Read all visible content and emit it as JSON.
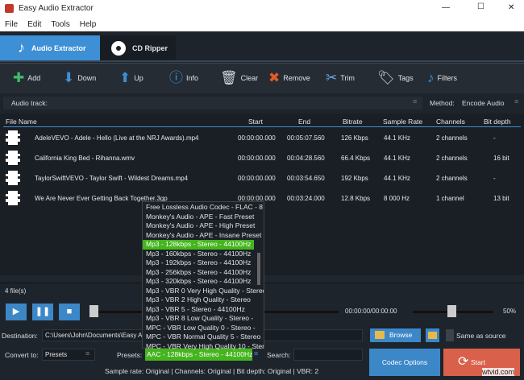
{
  "window": {
    "title": "Easy Audio Extractor",
    "minimize": "—",
    "maximize": "☐",
    "close": "✕"
  },
  "menu": [
    "File",
    "Edit",
    "Tools",
    "Help"
  ],
  "tabs": [
    {
      "label": "Audio Extractor",
      "active": true
    },
    {
      "label": "CD Ripper",
      "active": false
    }
  ],
  "toolbar": [
    {
      "label": "Add",
      "icon": "plus-icon",
      "glyph": "✚",
      "color": "#3dbb6b"
    },
    {
      "label": "Down",
      "icon": "arrow-down-icon",
      "glyph": "⬇",
      "color": "#3d8fd6"
    },
    {
      "label": "Up",
      "icon": "arrow-up-icon",
      "glyph": "⬆",
      "color": "#3d8fd6"
    },
    {
      "label": "Info",
      "icon": "info-icon",
      "glyph": "ⓘ",
      "color": "#3d8fd6"
    },
    {
      "label": "Clear",
      "icon": "trash-icon",
      "glyph": "🗑",
      "color": "#cfd6dd"
    },
    {
      "label": "Remove",
      "icon": "x-icon",
      "glyph": "✖",
      "color": "#e05a2a"
    },
    {
      "label": "Trim",
      "icon": "scissors-icon",
      "glyph": "✂",
      "color": "#6aa8e0"
    },
    {
      "label": "Tags",
      "icon": "tag-icon",
      "glyph": "🏷",
      "color": "#cfd6dd"
    },
    {
      "label": "Filters",
      "icon": "music-note-icon",
      "glyph": "♪",
      "color": "#3d8fd6"
    }
  ],
  "audio_track": {
    "label": "Audio track:",
    "value": ""
  },
  "method": {
    "label": "Method:",
    "value": "Encode Audio"
  },
  "table": {
    "columns": [
      "File Name",
      "Start",
      "End",
      "Bitrate",
      "Sample Rate",
      "Channels",
      "Bit depth"
    ],
    "rows": [
      [
        "AdeleVEVO - Adele - Hello (Live at the NRJ Awards).mp4",
        "00:00:00.000",
        "00:05:07.560",
        "126 Kbps",
        "44.1 KHz",
        "2 channels",
        "-"
      ],
      [
        "California King Bed - Rihanna.wmv",
        "00:00:00.000",
        "00:04:28.560",
        "66.4 Kbps",
        "44.1 KHz",
        "2 channels",
        "16 bit"
      ],
      [
        "TaylorSwiftVEVO - Taylor Swift - Wildest Dreams.mp4",
        "00:00:00.000",
        "00:03:54.650",
        "192 Kbps",
        "44.1 KHz",
        "2 channels",
        "-"
      ],
      [
        "We Are Never Ever Getting Back Together.3gp",
        "00:00:00.000",
        "00:03:24.000",
        "12.8 Kbps",
        "8 000 Hz",
        "1 channel",
        "13 bit"
      ]
    ]
  },
  "file_count": "4 file(s)",
  "player": {
    "time": "00:00:00/00:00:00",
    "volume": "50%",
    "volume_value": 50,
    "position_value": 0
  },
  "destination": {
    "label": "Destination:",
    "value": "C:\\Users\\John\\Documents\\Easy Audio Extractor"
  },
  "browse": "Browse",
  "same_as_source": {
    "label": "Same as source",
    "checked": false
  },
  "convert_to": {
    "label": "Convert to:",
    "value": "Presets"
  },
  "presets": {
    "label": "Presets:",
    "value": "AAC - 128kbps - Stereo - 44100Hz",
    "options": [
      "Free Lossless Audio Codec - FLAC - 8",
      "Monkey's Audio - APE - Fast Preset",
      "Monkey's Audio - APE - High Preset",
      "Monkey's Audio - APE - Insane Preset",
      "Mp3 - 128kbps - Stereo - 44100Hz",
      "Mp3 - 160kbps - Stereo - 44100Hz",
      "Mp3 - 192kbps - Stereo - 44100Hz",
      "Mp3 - 256kbps - Stereo - 44100Hz",
      "Mp3 - 320kbps - Stereo - 44100Hz",
      "Mp3 - VBR 0 Very High Quality - Stereo",
      "Mp3 - VBR 2 High Quality - Stereo",
      "Mp3 - VBR 5 - Stereo - 44100Hz",
      "Mp3 - VBR 8 Low Quality - Stereo - ",
      "MPC - VBR Low Quality 0 - Stereo - ",
      "MPC - VBR Normal Quality 5 - Stereo",
      "MPC - VBR Very High Quality 10 - Stereo"
    ],
    "highlighted": "Mp3 - 128kbps - Stereo - 44100Hz"
  },
  "search": {
    "label": "Search:",
    "value": ""
  },
  "codec_options": "Codec Options",
  "start": "Start",
  "status": "Sample rate: Original | Channels: Original | Bit depth: Original | VBR: 2",
  "watermark": "wtvid.com",
  "colors": {
    "accent": "#3d8fd6",
    "start": "#d9604a",
    "highlight": "#44b51d"
  }
}
